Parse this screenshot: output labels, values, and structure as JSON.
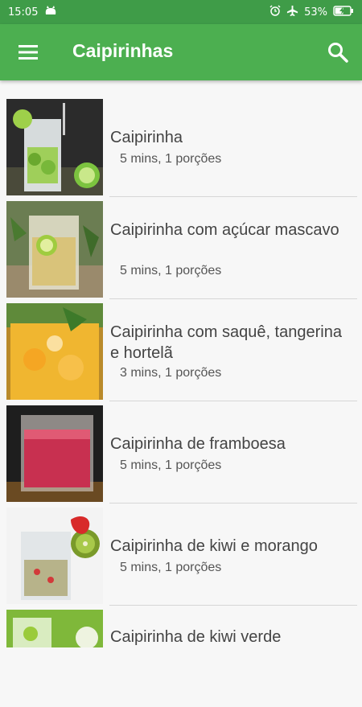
{
  "status_bar": {
    "time": "15:05",
    "battery": "53%"
  },
  "app_bar": {
    "title": "Caipirinhas"
  },
  "recipes": [
    {
      "title": "Caipirinha",
      "meta": "5 mins, 1 porções"
    },
    {
      "title": "Caipirinha com açúcar mascavo",
      "meta": "5 mins, 1 porções"
    },
    {
      "title": "Caipirinha com saquê, tangerina e hortelã",
      "meta": "3 mins, 1 porções"
    },
    {
      "title": "Caipirinha de framboesa",
      "meta": "5 mins, 1 porções"
    },
    {
      "title": "Caipirinha de kiwi e morango",
      "meta": "5 mins, 1 porções"
    },
    {
      "title": "Caipirinha de kiwi verde",
      "meta": ""
    }
  ]
}
